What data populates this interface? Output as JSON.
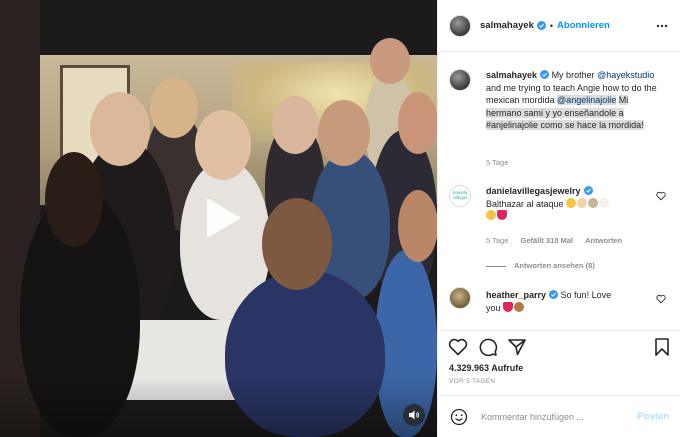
{
  "header": {
    "username": "salmahayek",
    "separator": "•",
    "follow_label": "Abonnieren"
  },
  "caption": {
    "username": "salmahayek",
    "text_1": "My brother",
    "mention_1": "@hayekstudio",
    "text_2": "and me trying to teach Angie how to do the mexican mordida",
    "mention_2": "@angelinajolie",
    "text_3": "Mi hermano sami y yo enseñandole a #anjelinajolie como se hace la mordida!",
    "time": "5 Tage"
  },
  "comments": [
    {
      "username": "danielavillegasjewelry",
      "avatar_text": "daniela villegas",
      "text": "Balthazar al ataque",
      "emoji_after_text": [
        "#f4c542",
        "#f2d2a9",
        "#c8b39a",
        "#f5f0ea"
      ],
      "emoji_line2": [
        "#f4c542",
        "#e0245e"
      ],
      "time": "5 Tage",
      "likes": "Gefällt 310 Mal",
      "reply_label": "Antworten",
      "view_replies": "Antworten ansehen (8)"
    },
    {
      "username": "heather_parry",
      "text_1": "So fun! Love",
      "text_2": "you",
      "emoji_after": [
        "#e0245e",
        "#b47a3c"
      ]
    }
  ],
  "stats": {
    "views": "4.329.963 Aufrufe",
    "date": "VOR 5 TAGEN"
  },
  "comment_box": {
    "placeholder": "Kommentar hinzufügen ...",
    "post_label": "Posten"
  },
  "icons": {
    "like": "heart-icon",
    "comment": "comment-icon",
    "share": "share-icon",
    "save": "bookmark-icon",
    "more": "more-icon",
    "play": "play-icon",
    "mute": "mute-icon",
    "emoji": "emoji-icon"
  },
  "colors": {
    "accent": "#0095f6",
    "post_disabled": "#b2dffc",
    "link": "#00376b",
    "verified": "#3897f0"
  }
}
